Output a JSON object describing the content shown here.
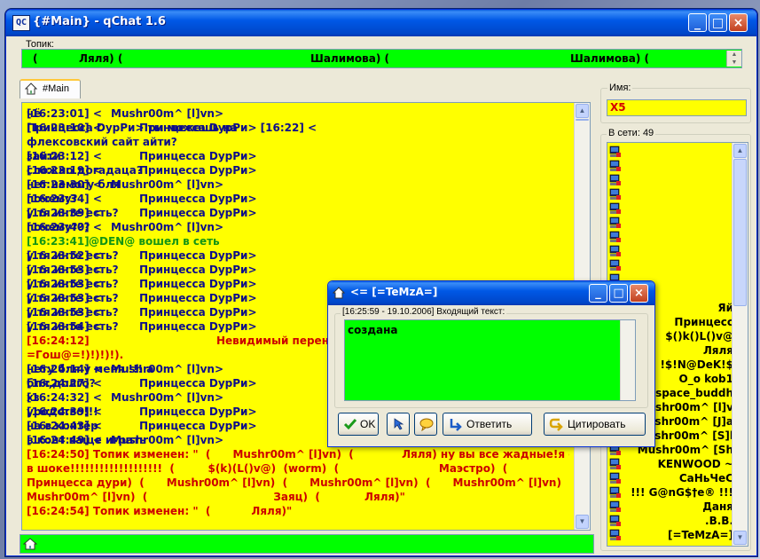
{
  "window": {
    "title": "{#Main} - qChat 1.6",
    "app_icon": "QC",
    "minimize": "_",
    "maximize": "□",
    "close": "×"
  },
  "topic": {
    "label": "Топик:",
    "segments": [
      "(",
      "Ляля)  (",
      "Шалимова)  (",
      "Шалимова)  ("
    ]
  },
  "tab": {
    "label": "#Main",
    "icon": "home-icon"
  },
  "chat": {
    "lines": [
      {
        "type": "msg",
        "ts": "[16:23:01] <",
        "nick": "Mushr00m^ [l]vn>",
        "msg": "чё",
        "indent": 0
      },
      {
        "type": "msg",
        "ts": "[16:23:10] <",
        "nick": "Принцесса DурРи> [16:22] <",
        "msg": "Принцесса DурРи> ты можешь на",
        "indent": 1
      },
      {
        "type": "wrap",
        "text": "флексовский сайт айти?"
      },
      {
        "type": "msg",
        "ts": "[16:23:12] <",
        "nick": "Принцесса DурРи>",
        "msg": "зайти",
        "indent": 1
      },
      {
        "type": "msg",
        "ts": "[16:23:19] <",
        "nick": "Принцесса DурРи>",
        "msg": "сложно догадаца?",
        "indent": 1
      },
      {
        "type": "msg",
        "ts": "[16:23:30] <",
        "nick": "Mushr00m^ [l]vn>",
        "msg": "нет немогу бля",
        "indent": 0
      },
      {
        "type": "msg",
        "ts": "[16:23:34] <",
        "nick": "Принцесса DурРи>",
        "msg": "почему?",
        "indent": 1
      },
      {
        "type": "msg",
        "ts": "[16:23:39] <",
        "nick": "Принцесса DурРи>",
        "msg": "у тя инте есть?",
        "indent": 1
      },
      {
        "type": "msg",
        "ts": "[16:23:40] <",
        "nick": "Mushr00m^ [l]vn>",
        "msg": "почему???",
        "indent": 0
      },
      {
        "type": "join",
        "ts": "[16:23:41]",
        "text": "@DEN@ вошел в сеть"
      },
      {
        "type": "msg",
        "ts": "[16:23:52] <",
        "nick": "Принцесса DурРи>",
        "msg": "у тя инте есть?",
        "indent": 1
      },
      {
        "type": "msg",
        "ts": "[16:23:53] <",
        "nick": "Принцесса DурРи>",
        "msg": "у тя инте есть?",
        "indent": 1
      },
      {
        "type": "msg",
        "ts": "[16:23:53] <",
        "nick": "Принцесса DурРи>",
        "msg": "у тя инте есть?",
        "indent": 1
      },
      {
        "type": "msg",
        "ts": "[16:23:53] <",
        "nick": "Принцесса DурРи>",
        "msg": "у тя инте есть?",
        "indent": 1
      },
      {
        "type": "msg",
        "ts": "[16:23:53] <",
        "nick": "Принцесса DурРи>",
        "msg": "у тя инте есть?",
        "indent": 1
      },
      {
        "type": "msg",
        "ts": "[16:23:54] <",
        "nick": "Принцесса DурРи>",
        "msg": "у тя инте есть?",
        "indent": 1
      },
      {
        "type": "red",
        "ts": "[16:24:12]",
        "text": "Невидимый перени"
      },
      {
        "type": "wrapred",
        "text": "=Гош@=!)!)!)!)."
      },
      {
        "type": "msg",
        "ts": "[16:24:14] <",
        "nick": "Mushr00m^ [l]vn>",
        "msg": "нету бля у меня !!! а",
        "indent": 0
      },
      {
        "type": "msg",
        "ts": "[16:24:27] <",
        "nick": "Принцесса DурРи>",
        "msg": "бля,долго?",
        "indent": 1
      },
      {
        "type": "msg",
        "ts": "[16:24:32] <",
        "nick": "Mushr00m^ [l]vn>",
        "msg": "хз",
        "indent": 0
      },
      {
        "type": "msg",
        "ts": "[16:24:39] <",
        "nick": "Принцесса DурРи>",
        "msg": "уродство!!!",
        "indent": 1
      },
      {
        "type": "msg",
        "ts": "[16:24:43] <",
        "nick": "Принцесса DурРи>",
        "msg": "на в контёр",
        "indent": 1
      },
      {
        "type": "msg",
        "ts": "[16:24:49] <",
        "nick": "Mushr00m^ [l]vn>",
        "msg": "в конт ваще играть",
        "indent": 0
      },
      {
        "type": "wrapred",
        "text": "[16:24:50] Топик изменен: \"  (      Mushr00m^ [l]vn)  (             Ляля) ну вы все жадные!я от вас"
      },
      {
        "type": "wrapred",
        "text": "в шоке!!!!!!!!!!!!!!!!!!!  (         $(k)(L()v@)  (worm)  (                           Маэстро)  ("
      },
      {
        "type": "wrapred",
        "text": "Принцесса дури)  (      Mushr00m^ [l]vn)  (      Mushr00m^ [l]vn)  (      Mushr00m^ [l]vn)  ("
      },
      {
        "type": "wrapred",
        "text": "Mushr00m^ [l]vn)  (                                  Заяц)  (            Ляля)\""
      },
      {
        "type": "wrapred",
        "text": "[16:24:54] Топик изменен: \"  (           Ляля)\""
      }
    ]
  },
  "right": {
    "name_label": "Имя:",
    "name_value": "X5",
    "online_label": "В сети: 49",
    "users": [
      "",
      "",
      "",
      "",
      "",
      "",
      "",
      "",
      "",
      "",
      "",
      "Яй",
      "Принцесс",
      "$()k()L()v@",
      "Ляля",
      "!$!N@DeK!$",
      "O_o kob1",
      "space_buddh",
      "Mushr00m^ [l]v",
      "Mushr00m^ [J]a",
      "Mushr00m^ [S]l",
      "Mushr00m^ [Sh",
      "KENWOOD ~",
      "CaНьЧеС",
      "!!! G@nG$†e® !!!",
      "Даня",
      ".B.B.",
      "[=TeMzA=]"
    ]
  },
  "dialog": {
    "title": "<= [=TeMzA=]",
    "group_label": "[16:25:59 - 19.10.2006] Входящий текст:",
    "text": "создана",
    "ok_label": "OK",
    "reply_label": "Ответить",
    "quote_label": "Цитировать"
  },
  "colors": {
    "chat_bg": "#ffff00",
    "topic_bg": "#00ff00",
    "nick_color": "#0d0d8a",
    "system_red": "#cc0000",
    "join_green": "#139513"
  }
}
